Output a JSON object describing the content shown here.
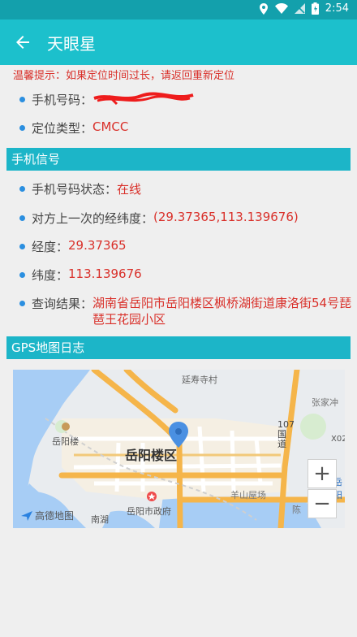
{
  "status_bar": {
    "time": "2:54",
    "icons": [
      "location-icon",
      "wifi-icon",
      "no-signal-icon",
      "battery-icon"
    ]
  },
  "app_bar": {
    "title": "天眼星",
    "back_icon": "arrow-left-icon"
  },
  "hint": "温馨提示：如果定位时间过长，请返回重新定位",
  "info": {
    "phone_label": "手机号码：",
    "type_label": "定位类型：",
    "type_value": "CMCC"
  },
  "signal_section": {
    "title": "手机信号",
    "status_label": "手机号码状态：",
    "status_value": "在线",
    "last_coord_label": "对方上一次的经纬度：",
    "last_coord_value": "(29.37365,113.139676)",
    "lat_label": "经度：",
    "lat_value": "29.37365",
    "lng_label": "纬度：",
    "lng_value": "113.139676",
    "result_label": "查询结果：",
    "result_value": "湖南省岳阳市岳阳楼区枫桥湖街道康洛街54号琵琶王花园小区"
  },
  "map_section": {
    "title": "GPS地图日志",
    "labels": {
      "district": "岳阳楼区",
      "temple": "延寿寺村",
      "tower": "岳阳楼",
      "gov": "岳阳市政府",
      "yangshan": "羊山屋场",
      "zhangjia": "张家冲",
      "road": "107国道",
      "x02": "X02",
      "yue": "岳阳",
      "lake": "南湖",
      "chen": "陈"
    },
    "zoom_in": "+",
    "zoom_out": "−",
    "logo": "高德地图"
  },
  "colors": {
    "primary": "#1cc0cc",
    "statusbar": "#13a0ac",
    "accent_red": "#d9302a",
    "bullet": "#2b8fe0"
  }
}
